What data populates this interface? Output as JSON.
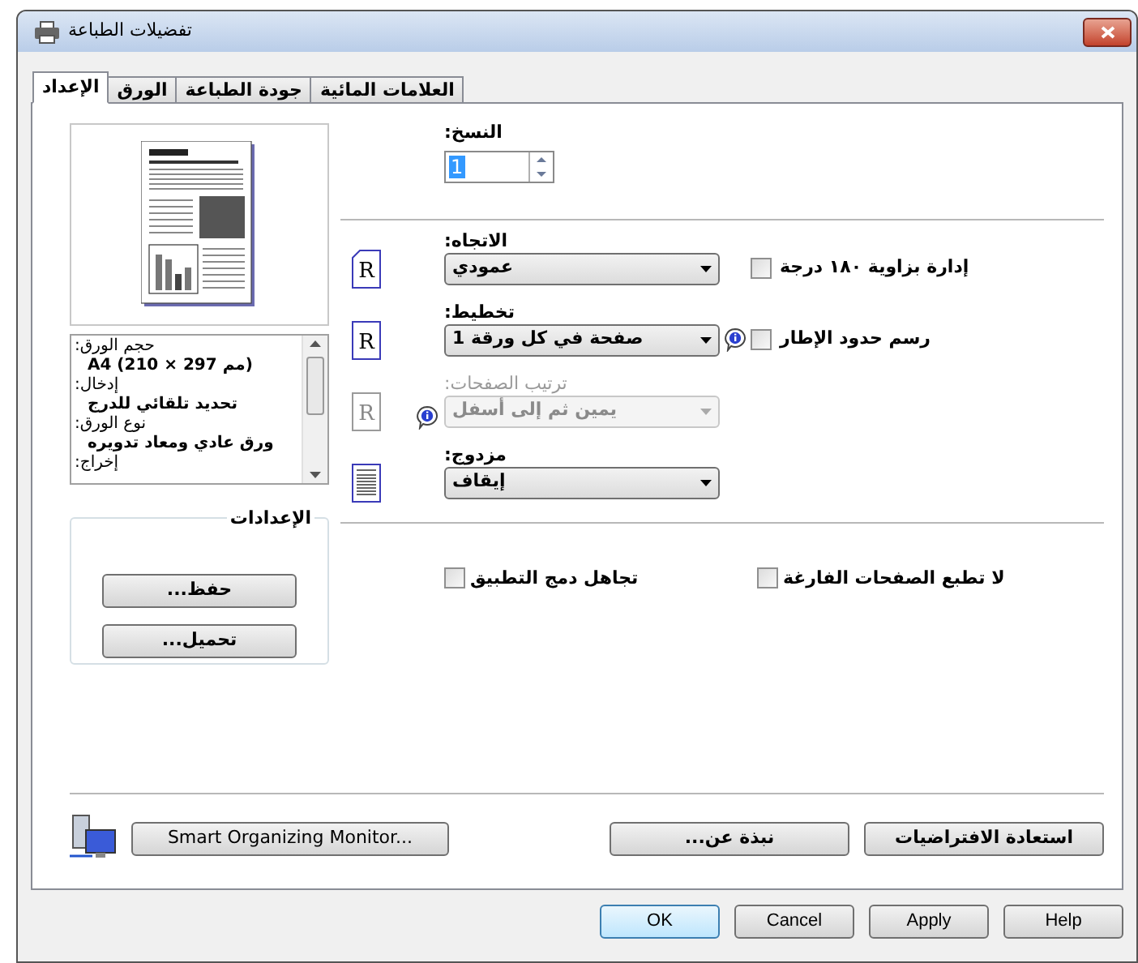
{
  "window": {
    "title": "تفضيلات الطباعة"
  },
  "tabs": [
    {
      "label": "العلامات المائية",
      "selected": false
    },
    {
      "label": "جودة الطباعة",
      "selected": false
    },
    {
      "label": "الورق",
      "selected": false
    },
    {
      "label": "الإعداد",
      "selected": true
    }
  ],
  "summary": [
    {
      "kind": "label",
      "text": ":حجم الورق"
    },
    {
      "kind": "value",
      "text": "A4 (210 × 297 مم)"
    },
    {
      "kind": "label",
      "text": ":إدخال"
    },
    {
      "kind": "value",
      "text": "تحديد تلقائي للدرج"
    },
    {
      "kind": "label",
      "text": ":نوع الورق"
    },
    {
      "kind": "value",
      "text": "ورق عادي ومعاد تدويره"
    },
    {
      "kind": "label",
      "text": ":إخراج"
    }
  ],
  "settings_group": {
    "title": "الإعدادات",
    "buttons": [
      "...حفظ",
      "...تحميل"
    ]
  },
  "copies": {
    "label": ":النسخ",
    "value": "1"
  },
  "rows": [
    {
      "kind": "orientation",
      "icon_text": "R",
      "label": ":الاتجاه",
      "value": "عمودي",
      "disabled": false,
      "checkbox": {
        "label": "إدارة بزاوية ١٨٠ درجة",
        "checked": false
      }
    },
    {
      "kind": "layout",
      "icon_text": "R",
      "label": ":تخطيط",
      "value": "صفحة في كل ورقة 1",
      "disabled": false,
      "info": true,
      "checkbox": {
        "label": "رسم حدود الإطار",
        "checked": false
      }
    },
    {
      "kind": "order",
      "icon_text": "R",
      "label": ":ترتيب الصفحات",
      "value": "يمين ثم إلى أسفل",
      "disabled": true,
      "info": true
    },
    {
      "kind": "duplex",
      "label": ":مزدوج",
      "value": "إيقاف",
      "disabled": false
    }
  ],
  "options": [
    {
      "label": "لا تطبع الصفحات الفارغة",
      "checked": false
    },
    {
      "label": "تجاهل دمج التطبيق",
      "checked": false
    }
  ],
  "bottom_buttons": [
    "استعادة الافتراضيات",
    "...نبذة عن",
    "Smart Organizing Monitor..."
  ],
  "dialog_buttons": [
    {
      "label": "Help",
      "default": false
    },
    {
      "label": "Apply",
      "default": false
    },
    {
      "label": "Cancel",
      "default": false
    },
    {
      "label": "OK",
      "default": true
    }
  ]
}
